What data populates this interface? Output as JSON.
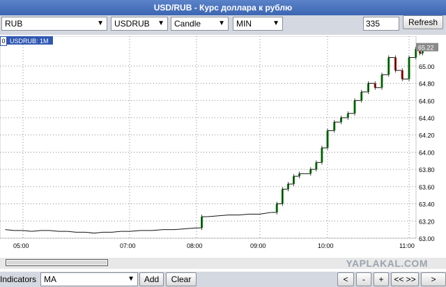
{
  "window": {
    "title": "USD/RUB - Курс доллара к рублю"
  },
  "toolbar": {
    "currency": "RUB",
    "symbol": "USDRUB",
    "chart_type": "Candle",
    "period": "MIN",
    "bars": "335",
    "refresh_label": "Refresh"
  },
  "chart": {
    "legend_index": "0",
    "legend_label": "USDRUB: 1M",
    "last_price": "65.22",
    "y_ticks": [
      "65.00",
      "64.80",
      "64.60",
      "64.40",
      "64.20",
      "64.00",
      "63.80",
      "63.60",
      "63.40",
      "63.20",
      "63.00"
    ],
    "x_ticks": [
      "05:00",
      "07:00",
      "08:00",
      "09:00",
      "10:00",
      "11:00"
    ]
  },
  "colors": {
    "up": "#0a8a0a",
    "down": "#b00000",
    "flat": "#111111",
    "accent": "#2f58b2",
    "last_price_bg": "#8a8a8a"
  },
  "chart_data": {
    "type": "candlestick",
    "xlabel": "",
    "ylabel": "",
    "ylim": [
      63.0,
      65.25
    ],
    "y_ticks": [
      63.0,
      63.2,
      63.4,
      63.6,
      63.8,
      64.0,
      64.2,
      64.4,
      64.6,
      64.8,
      65.0
    ],
    "x_ticks": [
      "05:00",
      "07:00",
      "08:00",
      "09:00",
      "10:00",
      "11:00"
    ],
    "grid": true,
    "last_price": 65.22,
    "series": [
      {
        "values": [
          [
            "04:40",
            63.1
          ],
          [
            "04:50",
            63.09
          ],
          [
            "05:00",
            63.09
          ],
          [
            "05:10",
            63.08
          ],
          [
            "05:20",
            63.09
          ],
          [
            "05:30",
            63.09
          ],
          [
            "05:40",
            63.08
          ],
          [
            "05:50",
            63.08
          ],
          [
            "06:00",
            63.07
          ],
          [
            "06:10",
            63.07
          ],
          [
            "06:20",
            63.06
          ],
          [
            "06:30",
            63.07
          ],
          [
            "06:40",
            63.07
          ],
          [
            "06:50",
            63.08
          ],
          [
            "07:00",
            63.08
          ],
          [
            "07:10",
            63.09
          ],
          [
            "07:20",
            63.09
          ],
          [
            "07:30",
            63.1
          ],
          [
            "07:40",
            63.1
          ],
          [
            "07:50",
            63.11
          ],
          [
            "08:00",
            63.12
          ],
          [
            "08:05",
            63.25
          ],
          [
            "08:10",
            63.25
          ],
          [
            "08:20",
            63.26
          ],
          [
            "08:30",
            63.27
          ],
          [
            "08:40",
            63.27
          ],
          [
            "08:50",
            63.28
          ],
          [
            "09:00",
            63.28
          ],
          [
            "09:10",
            63.3
          ],
          [
            "09:15",
            63.4
          ],
          [
            "09:20",
            63.57
          ],
          [
            "09:25",
            63.63
          ],
          [
            "09:30",
            63.72
          ],
          [
            "09:35",
            63.75
          ],
          [
            "09:40",
            63.75
          ],
          [
            "09:45",
            63.8
          ],
          [
            "09:50",
            63.88
          ],
          [
            "09:55",
            64.05
          ],
          [
            "10:00",
            64.25
          ],
          [
            "10:05",
            64.35
          ],
          [
            "10:10",
            64.4
          ],
          [
            "10:15",
            64.45
          ],
          [
            "10:20",
            64.6
          ],
          [
            "10:25",
            64.7
          ],
          [
            "10:30",
            64.8
          ],
          [
            "10:35",
            64.75
          ],
          [
            "10:40",
            64.9
          ],
          [
            "10:45",
            65.1
          ],
          [
            "10:50",
            64.95
          ],
          [
            "10:55",
            64.85
          ],
          [
            "11:00",
            65.1
          ],
          [
            "11:05",
            65.2
          ],
          [
            "11:08",
            65.15
          ],
          [
            "11:10",
            65.22
          ]
        ]
      }
    ]
  }
}
